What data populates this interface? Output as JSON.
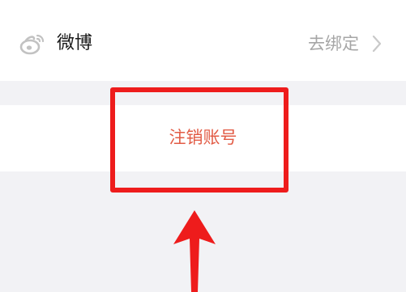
{
  "account_bindings": {
    "weibo": {
      "icon": "weibo-icon",
      "label": "微博",
      "action_label": "去绑定",
      "chevron_icon": "chevron-right-icon"
    }
  },
  "cancel_account": {
    "label": "注销账号",
    "color": "#e25b45"
  },
  "annotation": {
    "highlight_color": "#ee1c1c",
    "arrow_color": "#ee1c1c"
  }
}
